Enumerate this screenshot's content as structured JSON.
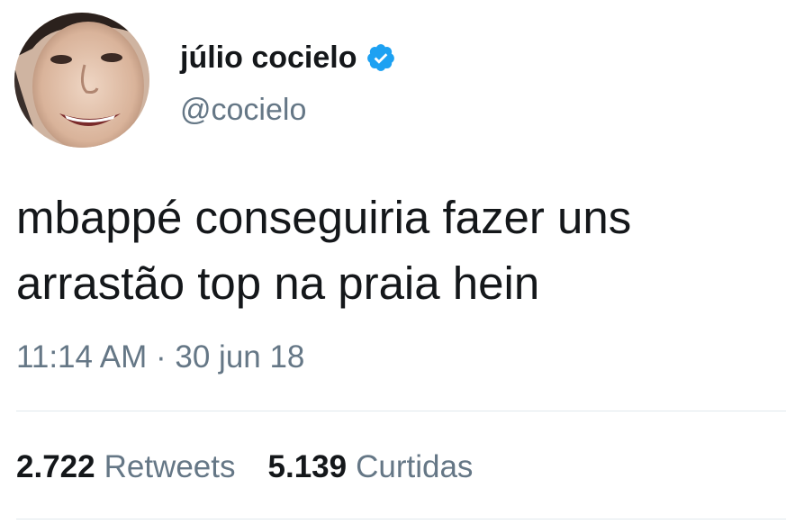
{
  "author": {
    "display_name": "júlio cocielo",
    "handle": "@cocielo",
    "verified_icon": "verified-badge-icon",
    "avatar_icon": "profile-photo"
  },
  "tweet": {
    "text_line1": "mbappé conseguiria fazer uns",
    "text_line2": "arrastão top na praia hein",
    "timestamp": "11:14 AM · 30 jun 18"
  },
  "stats": {
    "retweets_count": "2.722",
    "retweets_label": "Retweets",
    "likes_count": "5.139",
    "likes_label": "Curtidas"
  },
  "colors": {
    "text": "#14171a",
    "secondary": "#657786",
    "verified": "#1da1f2",
    "divider": "#e1e8ed"
  }
}
